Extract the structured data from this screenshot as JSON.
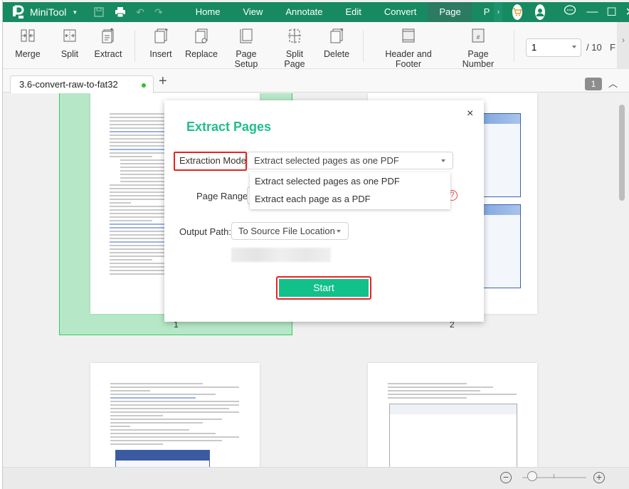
{
  "app": {
    "name": "MiniTool",
    "brand_color": "#178a62",
    "accent_color": "#12c08a"
  },
  "titlebar": {
    "menu": [
      {
        "label": "Home",
        "active": false
      },
      {
        "label": "View",
        "active": false
      },
      {
        "label": "Annotate",
        "active": false
      },
      {
        "label": "Edit",
        "active": false
      },
      {
        "label": "Convert",
        "active": false
      },
      {
        "label": "Page",
        "active": true
      },
      {
        "label": "P",
        "active": false
      }
    ],
    "more": "›",
    "icons": [
      "save-icon",
      "print-icon",
      "undo-icon",
      "redo-icon",
      "cart-icon",
      "user-icon",
      "chat-icon",
      "minimize-icon",
      "maximize-icon",
      "close-icon"
    ],
    "minimize": "—",
    "maximize": "☐",
    "close": "✕"
  },
  "ribbon": {
    "buttons": [
      {
        "id": "merge",
        "label": "Merge"
      },
      {
        "id": "split",
        "label": "Split"
      },
      {
        "id": "extract",
        "label": "Extract"
      },
      {
        "id": "insert",
        "label": "Insert"
      },
      {
        "id": "replace",
        "label": "Replace"
      },
      {
        "id": "page-setup",
        "label": "Page Setup"
      },
      {
        "id": "split-page",
        "label": "Split Page"
      },
      {
        "id": "delete",
        "label": "Delete"
      },
      {
        "id": "header-footer",
        "label": "Header and Footer"
      },
      {
        "id": "page-number",
        "label": "Page Number"
      }
    ],
    "page_select_value": "1",
    "page_total": "/ 10",
    "truncated_label": "F",
    "more": "›"
  },
  "tabs": {
    "document_tab": "3.6-convert-raw-to-fat32",
    "add": "+",
    "page_badge": "1",
    "collapse": "︿"
  },
  "canvas": {
    "page_labels": [
      "1",
      "2"
    ]
  },
  "dialog": {
    "title": "Extract Pages",
    "close": "×",
    "extraction_mode_label": "Extraction Mode:",
    "extraction_mode_value": "Extract selected pages as one PDF",
    "extraction_mode_options": [
      "Extract selected pages as one PDF",
      "Extract each page as a PDF"
    ],
    "page_range_label": "Page Range:",
    "help": "?",
    "output_path_label": "Output Path:",
    "output_path_value": "To Source File Location",
    "start_label": "Start"
  },
  "statusbar": {
    "zoom_out": "−",
    "zoom_in": "+",
    "zoom_level_fraction": 0.15
  }
}
